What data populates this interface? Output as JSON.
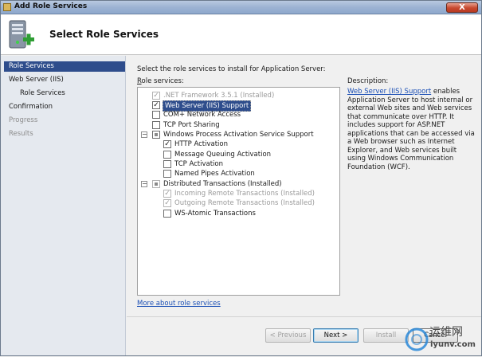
{
  "window": {
    "title": "Add Role Services",
    "close_label": "X"
  },
  "header": {
    "title": "Select Role Services"
  },
  "sidebar": {
    "items": [
      {
        "label": "Role Services",
        "state": "active"
      },
      {
        "label": "Web Server (IIS)",
        "state": "normal"
      },
      {
        "label": "Role Services",
        "state": "sub"
      },
      {
        "label": "Confirmation",
        "state": "normal"
      },
      {
        "label": "Progress",
        "state": "disabled"
      },
      {
        "label": "Results",
        "state": "disabled"
      }
    ]
  },
  "main": {
    "instructions": "Select the role services to install for Application Server:",
    "role_services_label_accel": "R",
    "role_services_label_rest": "ole services:",
    "tree": [
      {
        "label": ".NET Framework 3.5.1  (Installed)",
        "check": "✓",
        "style": "grey"
      },
      {
        "label": "Web Server (IIS) Support",
        "check": "✓",
        "style": "selected"
      },
      {
        "label": "COM+ Network Access",
        "check": "",
        "style": "normal"
      },
      {
        "label": "TCP Port Sharing",
        "check": "",
        "style": "normal"
      },
      {
        "label": "Windows Process Activation Service Support",
        "check": "",
        "style": "normal",
        "expander": "−"
      },
      {
        "label": "HTTP Activation",
        "check": "✓",
        "style": "normal"
      },
      {
        "label": "Message Queuing Activation",
        "check": "",
        "style": "normal"
      },
      {
        "label": "TCP Activation",
        "check": "",
        "style": "normal"
      },
      {
        "label": "Named Pipes Activation",
        "check": "",
        "style": "normal"
      },
      {
        "label": "Distributed Transactions  (Installed)",
        "check": "",
        "style": "normal",
        "expander": "−"
      },
      {
        "label": "Incoming Remote Transactions  (Installed)",
        "check": "✓",
        "style": "grey"
      },
      {
        "label": "Outgoing Remote Transactions  (Installed)",
        "check": "✓",
        "style": "grey"
      },
      {
        "label": "WS-Atomic Transactions",
        "check": "",
        "style": "normal"
      }
    ],
    "more_link": "More about role services"
  },
  "description": {
    "title": "Description:",
    "link": "Web Server (IIS) Support",
    "body": " enables Application Server to host internal or external Web sites and Web services that communicate over HTTP. It includes support for ASP.NET applications that can be accessed via a Web browser such as Internet Explorer, and Web services built using Windows Communication Foundation (WCF)."
  },
  "buttons": {
    "previous": "< Previous",
    "next": "Next >",
    "install": "Install",
    "cancel": "Cancel"
  },
  "watermark": {
    "line1": "运维网",
    "line2": "iyunv.com"
  },
  "colors": {
    "selection": "#2e4d8c",
    "link": "#1b4fb5",
    "sidebar": "#e5e9ef"
  }
}
